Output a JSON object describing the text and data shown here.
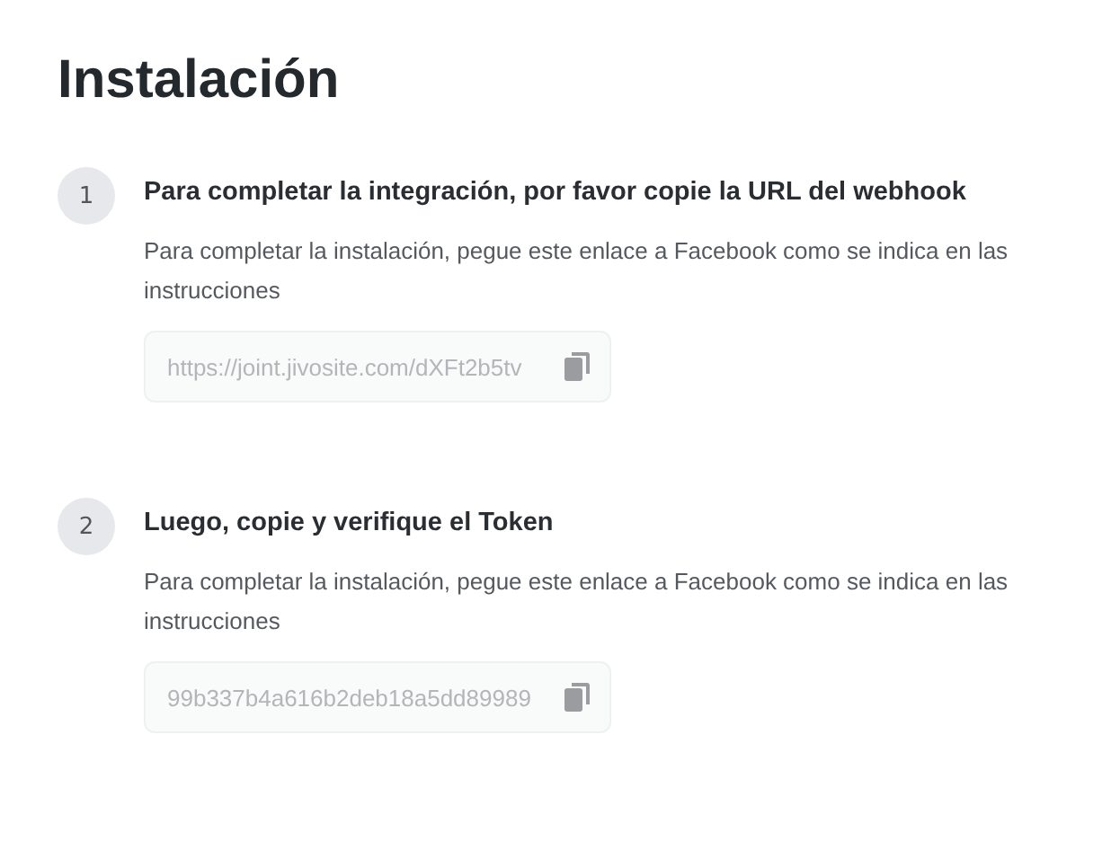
{
  "title": "Instalación",
  "steps": [
    {
      "number": "1",
      "heading": "Para completar la integración, por favor copie la URL del webhook",
      "description": "Para completar la instalación, pegue este enlace a Facebook como se indica en las instrucciones",
      "value": "https://joint.jivosite.com/dXFt2b5tv"
    },
    {
      "number": "2",
      "heading": "Luego, copie y verifique el Token",
      "description": "Para completar la instalación, pegue este enlace a Facebook como se indica en las instrucciones",
      "value": "99b337b4a616b2deb18a5dd89989"
    }
  ]
}
